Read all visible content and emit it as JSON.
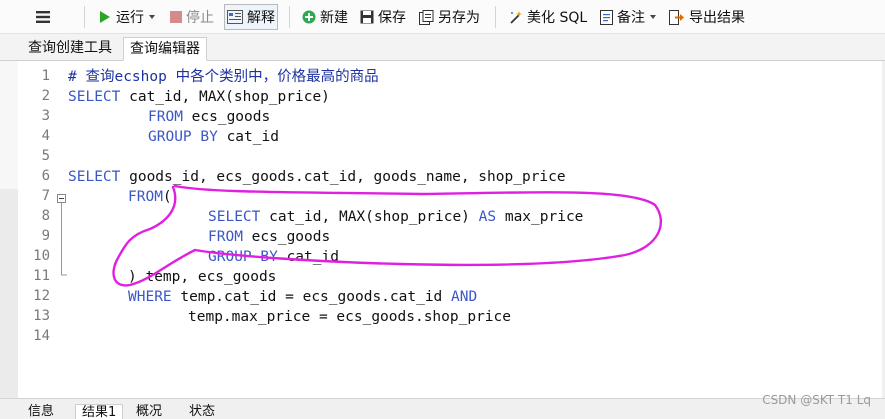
{
  "toolbar": {
    "run": "运行",
    "stop": "停止",
    "explain": "解释",
    "new": "新建",
    "save": "保存",
    "save_as": "另存为",
    "beautify": "美化 SQL",
    "comment": "备注",
    "export": "导出结果"
  },
  "tabs": [
    "查询创建工具",
    "查询编辑器"
  ],
  "editor": {
    "lines": [
      "1",
      "2",
      "3",
      "4",
      "5",
      "6",
      "7",
      "8",
      "9",
      "10",
      "11",
      "12",
      "13",
      "14"
    ],
    "code": {
      "l1": "# 查询ecshop 中各个类别中，价格最高的商品",
      "l2a": "SELECT",
      "l2b": " cat_id, MAX(shop_price)",
      "l3a": "FROM",
      "l3b": " ecs_goods",
      "l4a": "GROUP BY",
      "l4b": " cat_id",
      "l6a": "SELECT",
      "l6b": " goods_id, ecs_goods.cat_id, goods_name, shop_price",
      "l7a": "FROM",
      "l7b": "(",
      "l8a": "SELECT",
      "l8b": " cat_id, MAX(shop_price) ",
      "l8c": "AS",
      "l8d": " max_price",
      "l9a": "FROM",
      "l9b": " ecs_goods",
      "l10a": "GROUP BY",
      "l10b": " cat_id",
      "l11": ") temp, ecs_goods",
      "l12a": "WHERE",
      "l12b": " temp.cat_id = ecs_goods.cat_id ",
      "l12c": "AND",
      "l13": "temp.max_price = ecs_goods.shop_price"
    }
  },
  "bottom_tabs": [
    "信息",
    "结果1",
    "概况",
    "状态"
  ],
  "watermark": "CSDN @SKT T1 Lq",
  "colors": {
    "keyword": "#3a57c8",
    "comment": "#1d32a0",
    "annotation": "#e020e0",
    "run_icon": "#2aa52a",
    "stop_icon": "#d06a6a"
  }
}
